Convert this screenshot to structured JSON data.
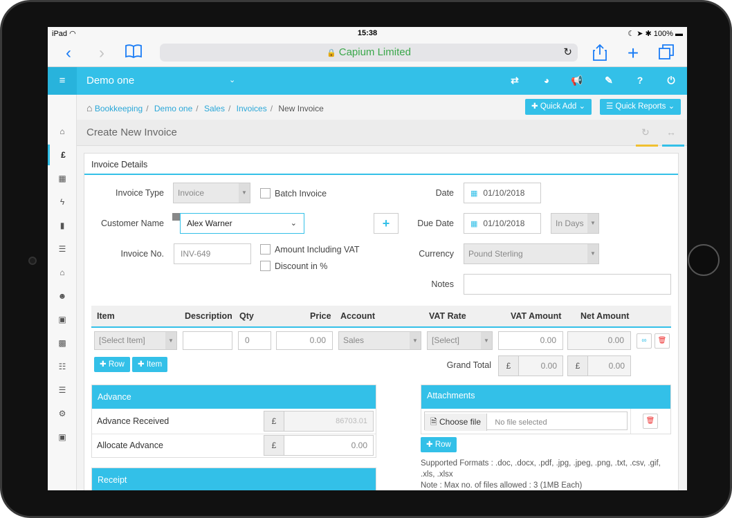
{
  "status": {
    "carrier": "iPad",
    "time": "15:38",
    "battery": "100%"
  },
  "browser": {
    "url_title": "Capium Limited"
  },
  "header": {
    "company": "Demo one"
  },
  "breadcrumb": {
    "home": "Bookkeeping",
    "b1": "Demo one",
    "b2": "Sales",
    "b3": "Invoices",
    "current": "New Invoice",
    "sep": "/"
  },
  "actions": {
    "quick_add": "Quick Add",
    "quick_reports": "Quick Reports"
  },
  "page": {
    "title": "Create New Invoice",
    "panel_title": "Invoice Details"
  },
  "form": {
    "invoice_type_label": "Invoice Type",
    "invoice_type_value": "Invoice",
    "batch_invoice_label": "Batch Invoice",
    "customer_name_label": "Customer Name",
    "customer_name_value": "Alex Warner",
    "invoice_no_label": "Invoice No.",
    "invoice_no_value": "INV-649",
    "amount_incl_vat_label": "Amount Including VAT",
    "discount_label": "Discount in %",
    "date_label": "Date",
    "date_value": "01/10/2018",
    "due_date_label": "Due Date",
    "due_date_value": "01/10/2018",
    "due_in_value": "In Days",
    "currency_label": "Currency",
    "currency_value": "Pound Sterling",
    "notes_label": "Notes"
  },
  "items": {
    "headers": {
      "item": "Item",
      "description": "Description",
      "qty": "Qty",
      "price": "Price",
      "account": "Account",
      "vat_rate": "VAT Rate",
      "vat_amount": "VAT Amount",
      "net_amount": "Net Amount"
    },
    "row": {
      "item": "[Select Item]",
      "qty": "0",
      "price": "0.00",
      "account": "Sales",
      "vat_rate": "[Select]",
      "vat_amount": "0.00",
      "net_amount": "0.00"
    },
    "add_row": "Row",
    "add_item": "Item",
    "grand_total_label": "Grand Total",
    "currency_symbol": "£",
    "grand_vat": "0.00",
    "grand_net": "0.00"
  },
  "advance": {
    "title": "Advance",
    "received_label": "Advance Received",
    "received_value": "86703.01",
    "allocate_label": "Allocate Advance",
    "allocate_value": "0.00"
  },
  "receipt": {
    "title": "Receipt"
  },
  "attachments": {
    "title": "Attachments",
    "choose_file": "Choose file",
    "no_file": "No file selected",
    "add_row": "Row",
    "formats": "Supported Formats : .doc, .docx, .pdf, .jpg, .jpeg, .png, .txt, .csv, .gif, .xls, .xlsx",
    "note": "Note : Max no. of files allowed : 3 (1MB Each)"
  }
}
